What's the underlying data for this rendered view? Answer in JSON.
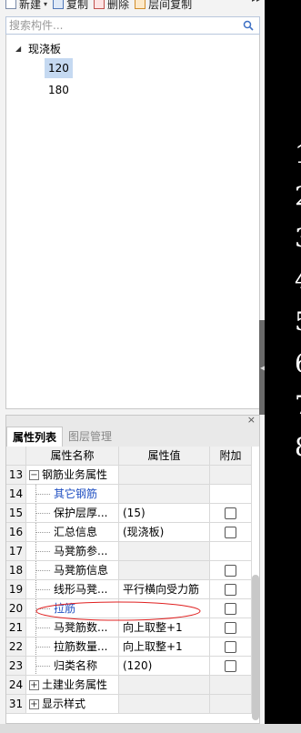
{
  "toolbar": {
    "new_label": "新建",
    "copy_label": "复制",
    "delete_label": "删除",
    "floor_copy_label": "层间复制",
    "more": "▸▸"
  },
  "search": {
    "placeholder": "搜索构件..."
  },
  "tree": {
    "root_label": "现浇板",
    "children": [
      "120",
      "180"
    ],
    "selected": "120"
  },
  "panel": {
    "close": "×",
    "tabs": [
      "属性列表",
      "图层管理"
    ],
    "columns": [
      "属性名称",
      "属性值",
      "附加"
    ],
    "rows": [
      {
        "num": "13",
        "name": "钢筋业务属性",
        "value": "",
        "expander": "−",
        "checkbox": false
      },
      {
        "num": "14",
        "name": "其它钢筋",
        "value": "",
        "checkbox": false,
        "blue": true
      },
      {
        "num": "15",
        "name": "保护层厚...",
        "value": "(15)",
        "checkbox": true
      },
      {
        "num": "16",
        "name": "汇总信息",
        "value": "(现浇板)",
        "checkbox": true
      },
      {
        "num": "17",
        "name": "马凳筋参...",
        "value": "",
        "checkbox": false
      },
      {
        "num": "18",
        "name": "马凳筋信息",
        "value": "",
        "checkbox": true
      },
      {
        "num": "19",
        "name": "线形马凳...",
        "value": "平行横向受力筋",
        "checkbox": true
      },
      {
        "num": "20",
        "name": "拉筋",
        "value": "",
        "checkbox": true,
        "blue": true
      },
      {
        "num": "21",
        "name": "马凳筋数...",
        "value": "向上取整+1",
        "checkbox": true
      },
      {
        "num": "22",
        "name": "拉筋数量...",
        "value": "向上取整+1",
        "checkbox": true
      },
      {
        "num": "23",
        "name": "归类名称",
        "value": "(120)",
        "checkbox": true
      },
      {
        "num": "24",
        "name": "土建业务属性",
        "value": "",
        "expander": "+",
        "checkbox": false
      },
      {
        "num": "31",
        "name": "显示样式",
        "value": "",
        "expander": "+",
        "checkbox": false
      }
    ]
  },
  "canvas_glyphs": [
    "1",
    "2",
    "3",
    "4",
    "5",
    "6",
    "7",
    "8"
  ],
  "colors": {
    "selection": "#c5d9f1",
    "link_text": "#1f4fc2",
    "annotation": "#e02020"
  }
}
